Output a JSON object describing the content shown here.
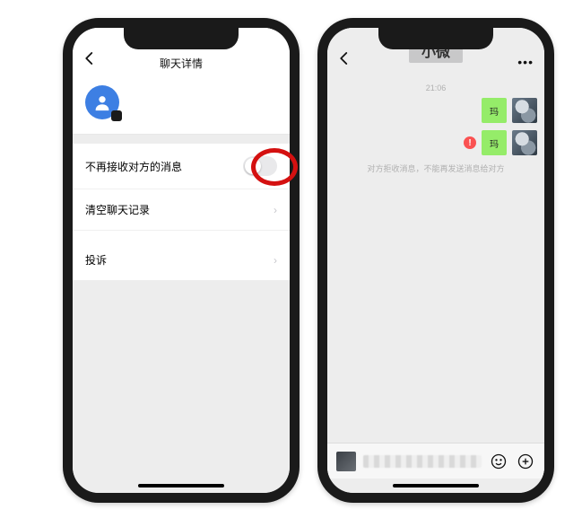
{
  "left_phone": {
    "header": {
      "back_icon": "chevron-left",
      "title": "聊天详情"
    },
    "avatar": {
      "icon": "person-default"
    },
    "settings": [
      {
        "label": "不再接收对方的消息",
        "type": "toggle",
        "on": false
      },
      {
        "label": "清空聊天记录",
        "type": "arrow"
      },
      {
        "label": "投诉",
        "type": "arrow"
      }
    ]
  },
  "right_phone": {
    "header": {
      "back_icon": "chevron-left",
      "title": "小微",
      "more_icon": "ellipsis"
    },
    "chat": {
      "time": "21:06",
      "messages": [
        {
          "text": "玛",
          "error": false
        },
        {
          "text": "玛",
          "error": true
        }
      ],
      "blocked_hint": "对方拒收消息，不能再发送消息给对方"
    },
    "input_bar": {
      "emoji_icon": "smile",
      "plus_icon": "plus"
    }
  }
}
